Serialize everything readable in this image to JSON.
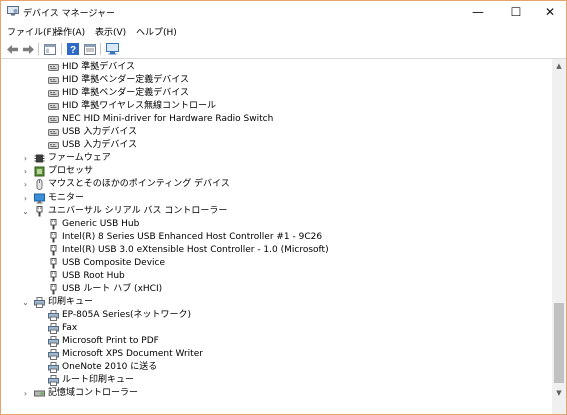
{
  "window": {
    "title": "デバイス マネージャー"
  },
  "window_controls": {
    "minimize": "—",
    "maximize": "☐",
    "close": "✕"
  },
  "menu": [
    "ファイル(F)",
    "操作(A)",
    "表示(V)",
    "ヘルプ(H)"
  ],
  "toolbar_icons": [
    "back-arrow-icon",
    "forward-arrow-icon",
    "properties-window-icon",
    "help-icon",
    "update-driver-icon",
    "scan-hardware-icon"
  ],
  "tree": [
    {
      "label": "HID 準拠デバイス",
      "level": 2,
      "icon": "hid-icon",
      "expander": ""
    },
    {
      "label": "HID 準拠ベンダー定義デバイス",
      "level": 2,
      "icon": "hid-icon",
      "expander": ""
    },
    {
      "label": "HID 準拠ベンダー定義デバイス",
      "level": 2,
      "icon": "hid-icon",
      "expander": ""
    },
    {
      "label": "HID 準拠ワイヤレス無線コントロール",
      "level": 2,
      "icon": "hid-icon",
      "expander": ""
    },
    {
      "label": "NEC HID Mini-driver for Hardware Radio Switch",
      "level": 2,
      "icon": "hid-icon",
      "expander": ""
    },
    {
      "label": "USB 入力デバイス",
      "level": 2,
      "icon": "hid-icon",
      "expander": ""
    },
    {
      "label": "USB 入力デバイス",
      "level": 2,
      "icon": "hid-icon",
      "expander": ""
    },
    {
      "label": "ファームウェア",
      "level": 1,
      "icon": "firmware-icon",
      "expander": "›"
    },
    {
      "label": "プロセッサ",
      "level": 1,
      "icon": "processor-icon",
      "expander": "›"
    },
    {
      "label": "マウスとそのほかのポインティング デバイス",
      "level": 1,
      "icon": "mouse-icon",
      "expander": "›"
    },
    {
      "label": "モニター",
      "level": 1,
      "icon": "monitor-icon",
      "expander": "›"
    },
    {
      "label": "ユニバーサル シリアル バス コントローラー",
      "level": 1,
      "icon": "usb-icon",
      "expander": "⌄"
    },
    {
      "label": "Generic USB Hub",
      "level": 2,
      "icon": "usb-icon",
      "expander": ""
    },
    {
      "label": "Intel(R) 8 Series USB Enhanced Host Controller #1 - 9C26",
      "level": 2,
      "icon": "usb-icon",
      "expander": ""
    },
    {
      "label": "Intel(R) USB 3.0 eXtensible Host Controller - 1.0 (Microsoft)",
      "level": 2,
      "icon": "usb-icon",
      "expander": ""
    },
    {
      "label": "USB Composite Device",
      "level": 2,
      "icon": "usb-icon",
      "expander": ""
    },
    {
      "label": "USB Root Hub",
      "level": 2,
      "icon": "usb-icon",
      "expander": ""
    },
    {
      "label": "USB ルート ハブ (xHCI)",
      "level": 2,
      "icon": "usb-icon",
      "expander": ""
    },
    {
      "label": "印刷キュー",
      "level": 1,
      "icon": "printer-icon",
      "expander": "⌄"
    },
    {
      "label": "EP-805A Series(ネットワーク)",
      "level": 2,
      "icon": "printer-icon",
      "expander": ""
    },
    {
      "label": "Fax",
      "level": 2,
      "icon": "printer-icon",
      "expander": ""
    },
    {
      "label": "Microsoft Print to PDF",
      "level": 2,
      "icon": "printer-icon",
      "expander": ""
    },
    {
      "label": "Microsoft XPS Document Writer",
      "level": 2,
      "icon": "printer-icon",
      "expander": ""
    },
    {
      "label": "OneNote 2010 に送る",
      "level": 2,
      "icon": "printer-icon",
      "expander": ""
    },
    {
      "label": "ルート印刷キュー",
      "level": 2,
      "icon": "printer-icon",
      "expander": ""
    },
    {
      "label": "記憶域コントローラー",
      "level": 1,
      "icon": "storage-controller-icon",
      "expander": "›"
    }
  ]
}
